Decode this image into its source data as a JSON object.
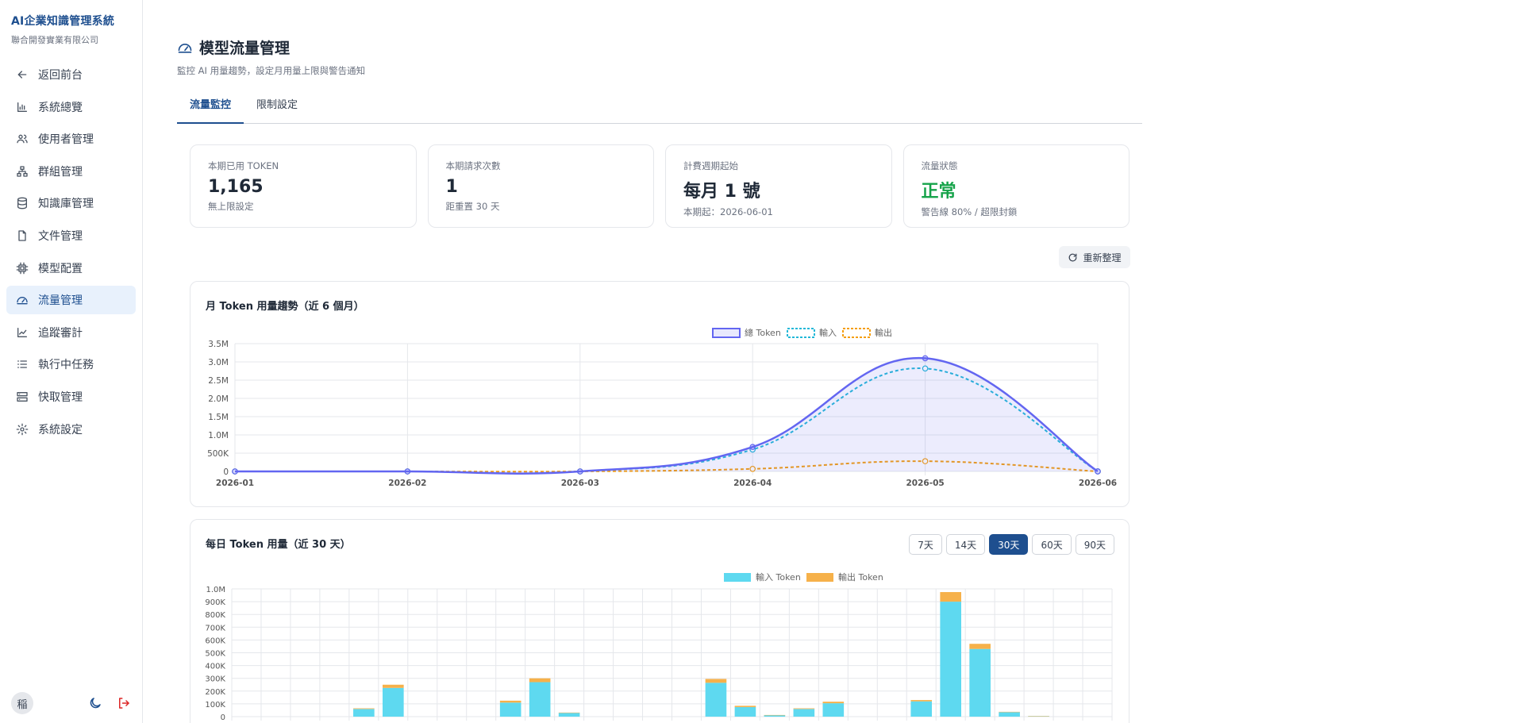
{
  "brand": {
    "title": "AI企業知識管理系統",
    "subtitle": "聯合開發實業有限公司"
  },
  "sidebar": {
    "items": [
      {
        "label": "返回前台",
        "icon": "arrow-left-icon"
      },
      {
        "label": "系統總覽",
        "icon": "bar-chart-icon"
      },
      {
        "label": "使用者管理",
        "icon": "users-icon"
      },
      {
        "label": "群組管理",
        "icon": "network-icon"
      },
      {
        "label": "知識庫管理",
        "icon": "database-icon"
      },
      {
        "label": "文件管理",
        "icon": "file-icon"
      },
      {
        "label": "模型配置",
        "icon": "chip-icon"
      },
      {
        "label": "流量管理",
        "icon": "gauge-icon",
        "active": true
      },
      {
        "label": "追蹤審計",
        "icon": "trend-icon"
      },
      {
        "label": "執行中任務",
        "icon": "list-icon"
      },
      {
        "label": "快取管理",
        "icon": "server-icon"
      },
      {
        "label": "系統設定",
        "icon": "gear-icon"
      }
    ],
    "footer": {
      "avatar": "稲",
      "theme_icon": "moon-icon",
      "logout_icon": "logout-icon"
    }
  },
  "page": {
    "title": "模型流量管理",
    "subtitle": "監控 AI 用量趨勢，設定月用量上限與警告通知"
  },
  "tabs": [
    {
      "label": "流量監控",
      "active": true
    },
    {
      "label": "限制設定",
      "active": false
    }
  ],
  "cards": [
    {
      "label": "本期已用 TOKEN",
      "value": "1,165",
      "note": "無上限設定"
    },
    {
      "label": "本期請求次數",
      "value": "1",
      "note": "距重置 30 天"
    },
    {
      "label": "計費週期起始",
      "value": "每月 1 號",
      "note": "本期起：2026-06-01"
    },
    {
      "label": "流量狀態",
      "value": "正常",
      "note": "警告線 80% / 超限封鎖",
      "status_color": "#16a34a"
    }
  ],
  "refresh_label": "重新整理",
  "monthly_panel": {
    "title": "月 Token 用量趨勢（近 6 個月）"
  },
  "daily_panel": {
    "title": "每日 Token 用量（近 30 天）",
    "ranges": [
      {
        "label": "7天",
        "active": false
      },
      {
        "label": "14天",
        "active": false
      },
      {
        "label": "30天",
        "active": true
      },
      {
        "label": "60天",
        "active": false
      },
      {
        "label": "90天",
        "active": false
      }
    ]
  },
  "chart_data": [
    {
      "type": "line",
      "x": [
        "2026-01",
        "2026-02",
        "2026-03",
        "2026-04",
        "2026-05",
        "2026-06"
      ],
      "series": [
        {
          "name": "總 Token",
          "values": [
            0,
            0,
            0,
            670000,
            3100000,
            1165
          ],
          "color": "#6366f1",
          "fill": true
        },
        {
          "name": "輸入",
          "values": [
            0,
            0,
            0,
            600000,
            2820000,
            1000
          ],
          "color": "#22b8d8",
          "dashed": true
        },
        {
          "name": "輸出",
          "values": [
            0,
            0,
            0,
            70000,
            280000,
            165
          ],
          "color": "#f59e0b",
          "dashed": true
        }
      ],
      "ylim": [
        0,
        3500000
      ],
      "yticks": [
        "0",
        "500K",
        "1.0M",
        "1.5M",
        "2.0M",
        "2.5M",
        "3.0M",
        "3.5M"
      ],
      "grid": true,
      "legend": "top-center"
    },
    {
      "type": "bar",
      "stacked": true,
      "categories": 30,
      "series": [
        {
          "name": "輸入 Token",
          "color": "#5ed9f0",
          "values": [
            0,
            0,
            0,
            0,
            60000,
            225000,
            0,
            0,
            0,
            110000,
            270000,
            30000,
            0,
            0,
            0,
            0,
            265000,
            75000,
            12000,
            60000,
            105000,
            0,
            0,
            120000,
            900000,
            530000,
            35000,
            4000,
            0,
            0
          ]
        },
        {
          "name": "輸出 Token",
          "color": "#f6b14a",
          "values": [
            0,
            0,
            0,
            0,
            5000,
            25000,
            0,
            0,
            0,
            15000,
            30000,
            2000,
            0,
            0,
            0,
            0,
            30000,
            10000,
            1000,
            5000,
            12000,
            0,
            0,
            10000,
            75000,
            40000,
            3000,
            500,
            0,
            0
          ]
        }
      ],
      "ylim": [
        0,
        1000000
      ],
      "yticks": [
        "0",
        "100K",
        "200K",
        "300K",
        "400K",
        "500K",
        "600K",
        "700K",
        "800K",
        "900K",
        "1.0M"
      ],
      "grid": true,
      "legend": "top-center"
    }
  ]
}
